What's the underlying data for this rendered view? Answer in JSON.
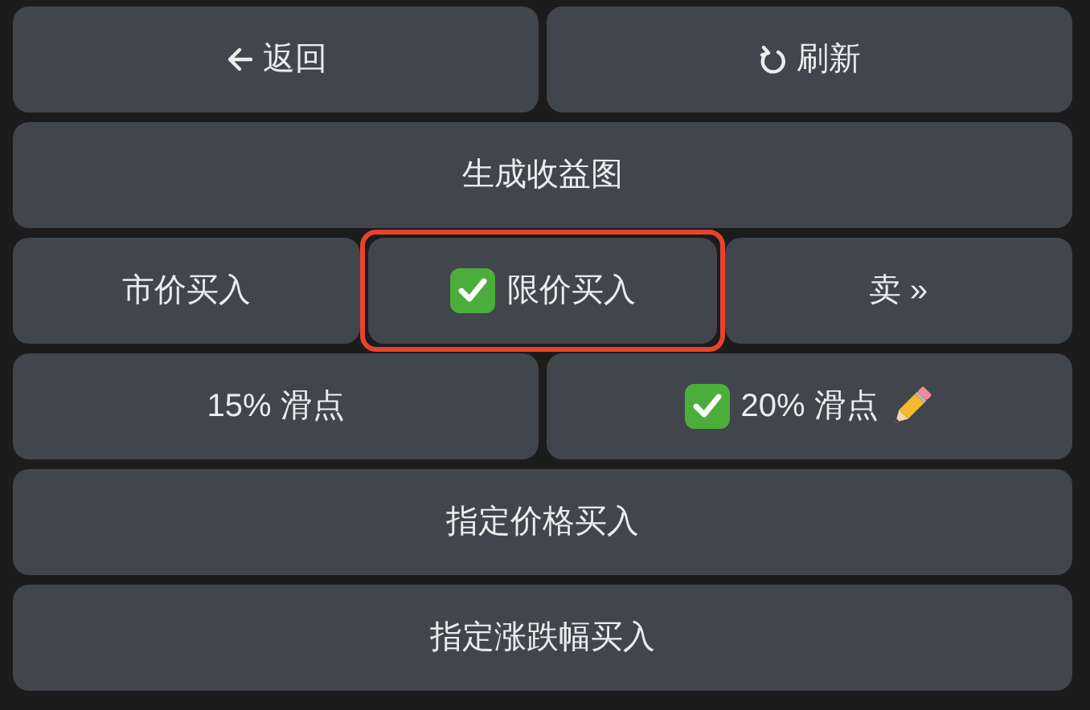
{
  "keyboard_rows": [
    {
      "buttons": [
        {
          "label": "返回",
          "kind": "back"
        },
        {
          "label": "刷新",
          "kind": "refresh"
        }
      ]
    },
    {
      "buttons": [
        {
          "label": "生成收益图",
          "kind": "plain"
        }
      ]
    },
    {
      "buttons": [
        {
          "label": "市价买入",
          "kind": "plain",
          "selected": false,
          "highlighted": false
        },
        {
          "label": "限价买入",
          "kind": "plain",
          "selected": true,
          "highlighted": true
        },
        {
          "label": "卖 »",
          "kind": "plain"
        }
      ]
    },
    {
      "buttons": [
        {
          "label": "15% 滑点",
          "kind": "plain",
          "selected": false
        },
        {
          "label": "20% 滑点",
          "kind": "edit",
          "selected": true
        }
      ]
    },
    {
      "buttons": [
        {
          "label": "指定价格买入",
          "kind": "plain"
        }
      ]
    },
    {
      "buttons": [
        {
          "label": "指定涨跌幅买入",
          "kind": "plain"
        }
      ]
    }
  ]
}
